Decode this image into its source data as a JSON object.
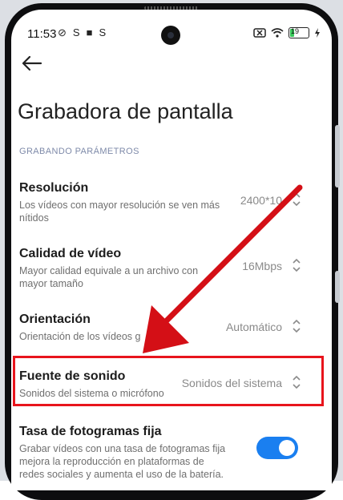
{
  "status_bar": {
    "time": "11:53",
    "icons_left": [
      "⊘",
      "S",
      "■",
      "S"
    ],
    "battery": "19"
  },
  "header": {
    "title": "Grabadora de pantalla"
  },
  "section": {
    "label": "GRABANDO PARÁMETROS"
  },
  "settings": [
    {
      "label": "Resolución",
      "desc": "Los vídeos con mayor resolución se ven más nítidos",
      "value": "2400*10"
    },
    {
      "label": "Calidad de vídeo",
      "desc": "Mayor calidad equivale a un archivo con mayor tamaño",
      "value": "16Mbps"
    },
    {
      "label": "Orientación",
      "desc": "Orientación de los vídeos g",
      "value": "Automático"
    },
    {
      "label": "Fuente de sonido",
      "desc": "Sonidos del sistema o micrófono",
      "value": "Sonidos del sistema"
    },
    {
      "label": "Tasa de fotogramas fija",
      "desc": "Grabar vídeos con una tasa de fotogramas fija mejora la reproducción en plataformas de redes sociales y aumenta el uso de la batería."
    }
  ],
  "colors": {
    "accent": "#1a7ff0",
    "annotation": "#e8141c"
  },
  "icons": {
    "back": "back-arrow-icon",
    "chevron": "chevron-updown-icon"
  }
}
